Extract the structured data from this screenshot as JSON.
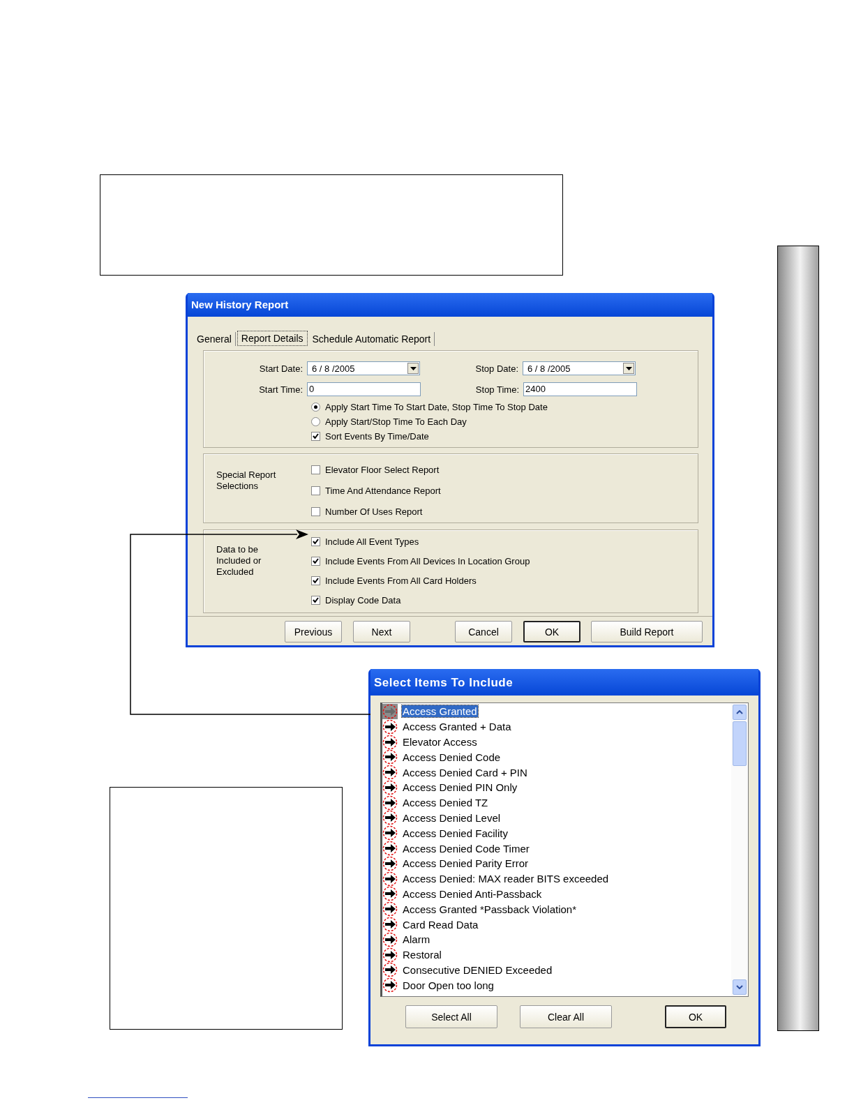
{
  "history_dialog": {
    "title": "New History Report",
    "tabs": [
      {
        "label": "General",
        "selected": false
      },
      {
        "label": "Report Details",
        "selected": true
      },
      {
        "label": "Schedule Automatic Report",
        "selected": false
      }
    ],
    "start_date": {
      "label": "Start Date:",
      "value": "6 / 8 /2005"
    },
    "stop_date": {
      "label": "Stop Date:",
      "value": "6 / 8 /2005"
    },
    "start_time": {
      "label": "Start Time:",
      "value": "0"
    },
    "stop_time": {
      "label": "Stop Time:",
      "value": "2400"
    },
    "time_options": [
      {
        "label": "Apply Start Time To Start Date, Stop Time To Stop Date",
        "selected": true
      },
      {
        "label": "Apply Start/Stop Time To Each Day",
        "selected": false
      }
    ],
    "sort_option": {
      "label": "Sort Events By Time/Date",
      "checked": true
    },
    "special_group": {
      "label": "Special Report Selections",
      "options": [
        {
          "label": "Elevator Floor Select Report",
          "checked": false
        },
        {
          "label": "Time And Attendance Report",
          "checked": false
        },
        {
          "label": "Number Of Uses Report",
          "checked": false
        }
      ]
    },
    "data_group": {
      "label": "Data to be Included or Excluded",
      "options": [
        {
          "label": "Include All Event Types",
          "checked": true
        },
        {
          "label": "Include Events From All Devices In Location Group",
          "checked": true
        },
        {
          "label": "Include Events From All Card Holders",
          "checked": true
        },
        {
          "label": "Display Code Data",
          "checked": true
        }
      ]
    },
    "buttons": [
      {
        "label": "Previous",
        "default": false
      },
      {
        "label": "Next",
        "default": false
      },
      {
        "label": "Cancel",
        "default": false
      },
      {
        "label": "OK",
        "default": true
      },
      {
        "label": "Build Report",
        "default": false
      }
    ]
  },
  "select_dialog": {
    "title": "Select Items To Include",
    "items": [
      {
        "label": "Access Granted",
        "selected": true
      },
      {
        "label": "Access Granted + Data",
        "selected": false
      },
      {
        "label": "Elevator Access",
        "selected": false
      },
      {
        "label": "Access Denied Code",
        "selected": false
      },
      {
        "label": "Access Denied Card + PIN",
        "selected": false
      },
      {
        "label": "Access Denied PIN Only",
        "selected": false
      },
      {
        "label": "Access Denied TZ",
        "selected": false
      },
      {
        "label": "Access Denied Level",
        "selected": false
      },
      {
        "label": "Access Denied Facility",
        "selected": false
      },
      {
        "label": "Access Denied Code Timer",
        "selected": false
      },
      {
        "label": "Access Denied Parity Error",
        "selected": false
      },
      {
        "label": "Access Denied: MAX reader BITS exceeded",
        "selected": false
      },
      {
        "label": "Access Denied Anti-Passback",
        "selected": false
      },
      {
        "label": "Access Granted *Passback Violation*",
        "selected": false
      },
      {
        "label": "Card Read Data",
        "selected": false
      },
      {
        "label": "Alarm",
        "selected": false
      },
      {
        "label": "Restoral",
        "selected": false
      },
      {
        "label": "Consecutive DENIED Exceeded",
        "selected": false
      },
      {
        "label": "Door Open too long",
        "selected": false
      }
    ],
    "buttons": [
      {
        "label": "Select All",
        "default": false
      },
      {
        "label": "Clear All",
        "default": false
      },
      {
        "label": "OK",
        "default": true
      }
    ]
  }
}
